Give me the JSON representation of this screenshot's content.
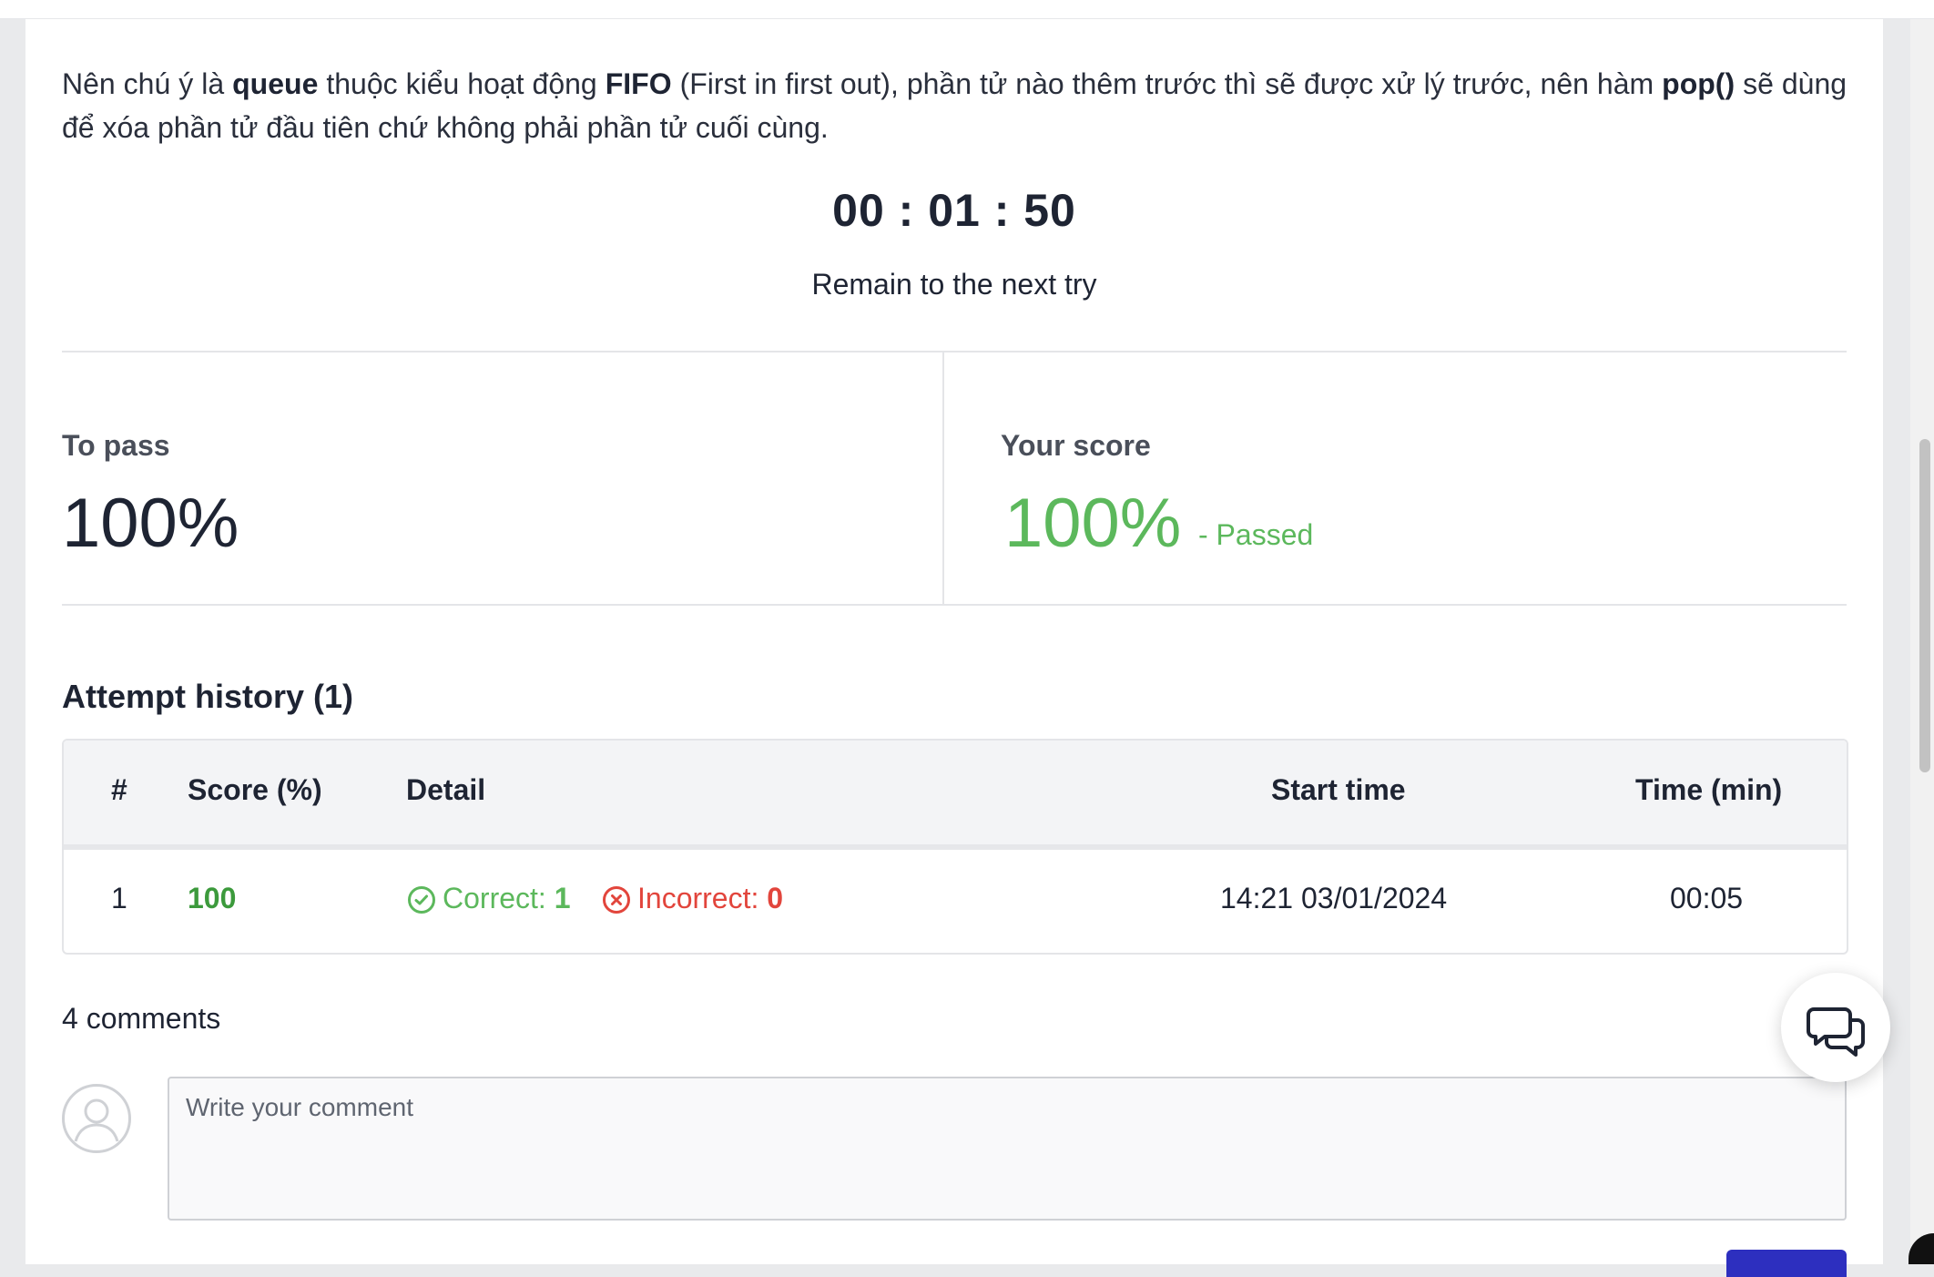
{
  "explanation": {
    "seg1": "Nên chú ý là ",
    "bold1": "queue",
    "seg2": " thuộc kiểu hoạt động ",
    "bold2": "FIFO",
    "seg3": " (First in first out), phần tử nào thêm trước thì sẽ được xử lý trước, nên hàm ",
    "bold3": "pop()",
    "seg4": " sẽ dùng để xóa phần tử đầu tiên chứ không phải phần tử cuối cùng."
  },
  "timer": {
    "value": "00 : 01 : 50",
    "caption": "Remain to the next try"
  },
  "scores": {
    "to_pass_label": "To pass",
    "to_pass_value": "100%",
    "your_score_label": "Your score",
    "your_score_value": "100%",
    "status": "- Passed"
  },
  "history": {
    "title": "Attempt history (1)",
    "columns": [
      "#",
      "Score (%)",
      "Detail",
      "Start time",
      "Time (min)"
    ],
    "rows": [
      {
        "index": "1",
        "score": "100",
        "correct_label": "Correct:",
        "correct_count": "1",
        "incorrect_label": "Incorrect:",
        "incorrect_count": "0",
        "start_time": "14:21 03/01/2024",
        "duration": "00:05"
      }
    ]
  },
  "comments": {
    "count_label": "4 comments",
    "placeholder": "Write your comment"
  },
  "colors": {
    "passed_green": "#5cb85c",
    "score_green": "#3c9a3c",
    "incorrect_red": "#e2453c",
    "submit_blue": "#2d2fbf"
  },
  "icons": {
    "correct": "check-circle-icon",
    "incorrect": "x-circle-icon",
    "chat": "chat-bubbles-icon",
    "avatar": "user-avatar-icon"
  }
}
